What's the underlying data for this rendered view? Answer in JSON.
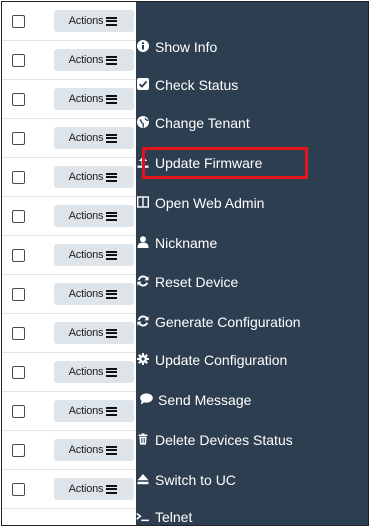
{
  "rows": [
    {
      "action_label": "Actions"
    },
    {
      "action_label": "Actions"
    },
    {
      "action_label": "Actions"
    },
    {
      "action_label": "Actions"
    },
    {
      "action_label": "Actions"
    },
    {
      "action_label": "Actions"
    },
    {
      "action_label": "Actions"
    },
    {
      "action_label": "Actions"
    },
    {
      "action_label": "Actions"
    },
    {
      "action_label": "Actions"
    },
    {
      "action_label": "Actions"
    },
    {
      "action_label": "Actions"
    },
    {
      "action_label": "Actions"
    }
  ],
  "menu": {
    "items": [
      {
        "label": "Show Info",
        "icon": "info-circle-icon"
      },
      {
        "label": "Check Status",
        "icon": "check-square-icon"
      },
      {
        "label": "Change Tenant",
        "icon": "globe-icon"
      },
      {
        "label": "Update Firmware",
        "icon": "upload-icon"
      },
      {
        "label": "Open Web Admin",
        "icon": "columns-icon"
      },
      {
        "label": "Nickname",
        "icon": "user-icon"
      },
      {
        "label": "Reset Device",
        "icon": "refresh-icon"
      },
      {
        "label": "Generate Configuration",
        "icon": "refresh-icon"
      },
      {
        "label": "Update Configuration",
        "icon": "gear-icon"
      },
      {
        "label": "Send Message",
        "icon": "comment-icon"
      },
      {
        "label": "Delete Devices Status",
        "icon": "trash-icon"
      },
      {
        "label": "Switch to UC",
        "icon": "eject-icon"
      },
      {
        "label": "Telnet",
        "icon": "terminal-icon"
      }
    ],
    "highlighted_item": "Update Firmware"
  },
  "colors": {
    "menu_bg": "#2d3e50",
    "highlight": "#e4141e",
    "button_bg": "#dde4ea"
  }
}
